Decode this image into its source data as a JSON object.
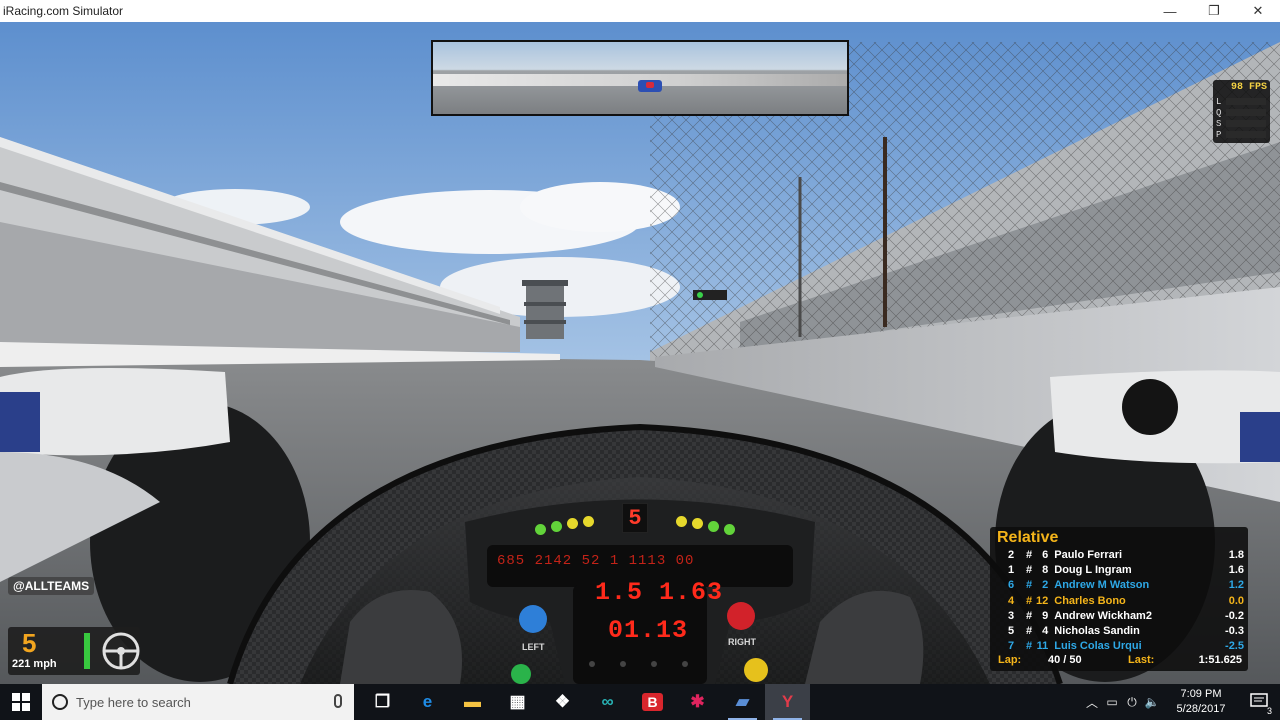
{
  "window": {
    "title": "iRacing.com Simulator",
    "controls": {
      "minimize": "—",
      "maximize": "❐",
      "close": "✕"
    }
  },
  "hud": {
    "fps": {
      "value": "98 FPS",
      "rows": [
        "L",
        "Q",
        "S",
        "P",
        "F"
      ]
    },
    "gear_display": "5",
    "dash_readout": "685 2142 52 1 1113 00",
    "lap_time_upper": "1.5 1.63",
    "lap_time_lower": "01.13",
    "left_button_label": "LEFT",
    "right_button_label": "RIGHT",
    "team_tag": "@ALLTEAMS",
    "gear": "5",
    "speed": "221 mph"
  },
  "relative": {
    "title": "Relative",
    "rows": [
      {
        "pos": "2",
        "hash": "#",
        "num": "6",
        "name": "Paulo Ferrari",
        "gap": "1.8",
        "color": "#ffffff"
      },
      {
        "pos": "1",
        "hash": "#",
        "num": "8",
        "name": "Doug L Ingram",
        "gap": "1.6",
        "color": "#ffffff"
      },
      {
        "pos": "6",
        "hash": "#",
        "num": "2",
        "name": "Andrew M Watson",
        "gap": "1.2",
        "color": "#2ea8e6"
      },
      {
        "pos": "4",
        "hash": "#",
        "num": "12",
        "name": "Charles Bono",
        "gap": "0.0",
        "color": "#f4b41a"
      },
      {
        "pos": "3",
        "hash": "#",
        "num": "9",
        "name": "Andrew Wickham2",
        "gap": "-0.2",
        "color": "#ffffff"
      },
      {
        "pos": "5",
        "hash": "#",
        "num": "4",
        "name": "Nicholas Sandin",
        "gap": "-0.3",
        "color": "#ffffff"
      },
      {
        "pos": "7",
        "hash": "#",
        "num": "11",
        "name": "Luis Colas Urqui",
        "gap": "-2.5",
        "color": "#2ea8e6"
      }
    ],
    "lap_label": "Lap:",
    "lap_value": "40 / 50",
    "last_label": "Last:",
    "last_value": "1:51.625"
  },
  "taskbar": {
    "search_placeholder": "Type here to search",
    "icons": [
      {
        "name": "task-view-icon",
        "glyph": "❐",
        "active": false,
        "running": false,
        "color": "#ffffff"
      },
      {
        "name": "edge-icon",
        "glyph": "e",
        "active": false,
        "running": false,
        "color": "#1f8ce6"
      },
      {
        "name": "file-explorer-icon",
        "glyph": "▬",
        "active": false,
        "running": false,
        "color": "#f5c342"
      },
      {
        "name": "store-icon",
        "glyph": "▦",
        "active": false,
        "running": false,
        "color": "#ffffff"
      },
      {
        "name": "dropbox-icon",
        "glyph": "❖",
        "active": false,
        "running": false,
        "color": "#ffffff"
      },
      {
        "name": "arduino-icon",
        "glyph": "∞",
        "active": false,
        "running": false,
        "color": "#28b3b5"
      },
      {
        "name": "bandicam-icon",
        "glyph": "B",
        "active": false,
        "running": false,
        "color": "#ffffff"
      },
      {
        "name": "slack-icon",
        "glyph": "✱",
        "active": false,
        "running": false,
        "color": "#e0245e"
      },
      {
        "name": "racing-app-icon",
        "glyph": "▰",
        "active": false,
        "running": true,
        "color": "#5a8ed6"
      },
      {
        "name": "iracing-icon",
        "glyph": "Y",
        "active": true,
        "running": true,
        "color": "#e23b4a"
      }
    ],
    "clock_time": "7:09 PM",
    "clock_date": "5/28/2017",
    "notification_count": "3"
  }
}
